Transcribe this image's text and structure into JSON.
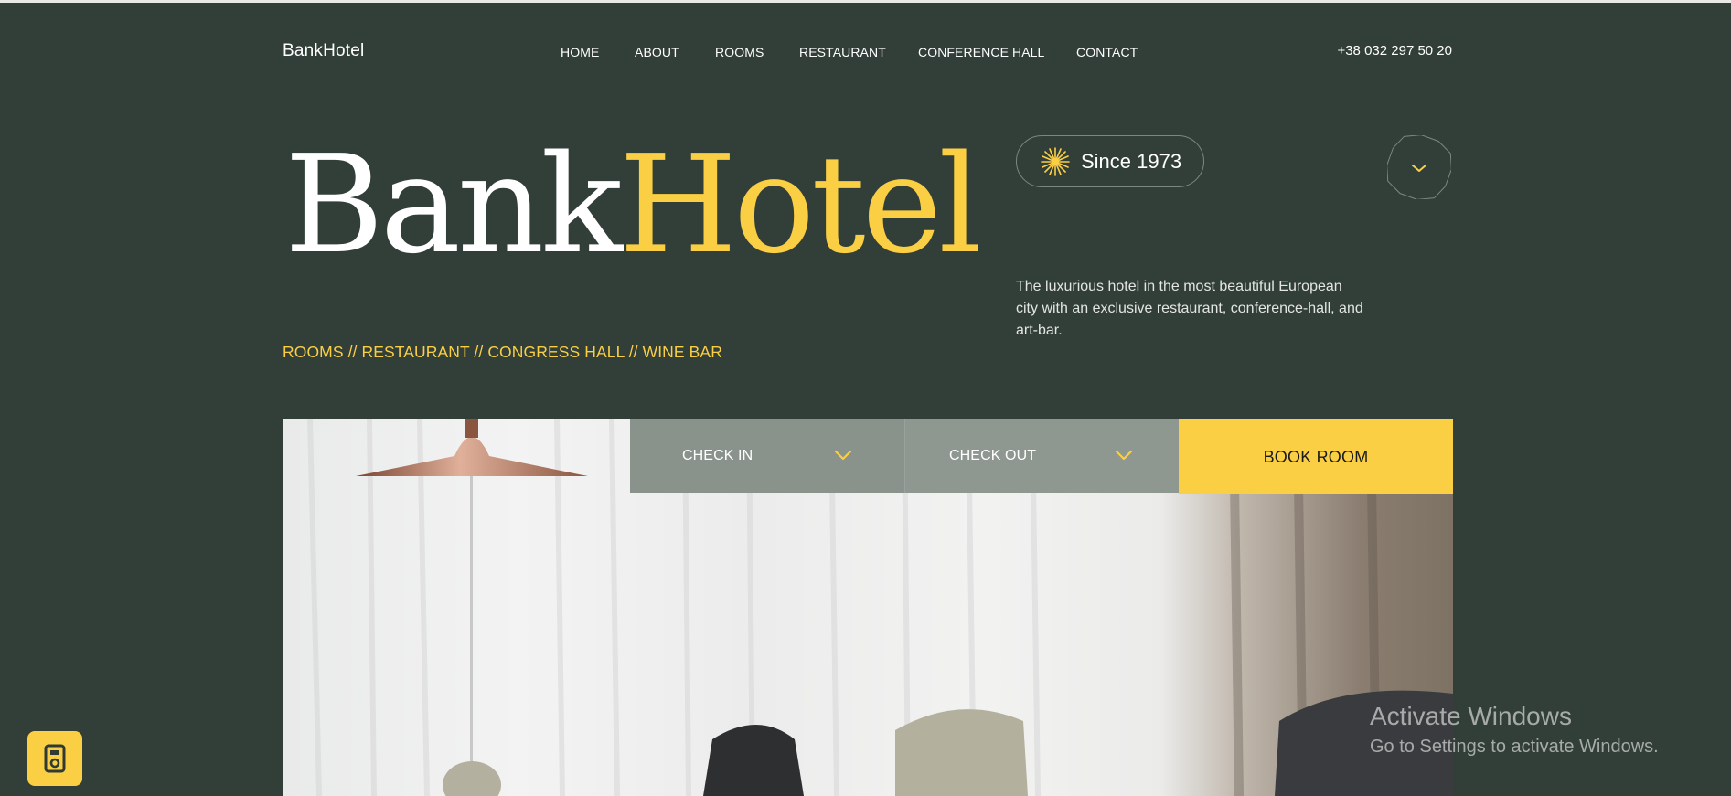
{
  "header": {
    "logo": "BankHotel",
    "nav": [
      "HOME",
      "ABOUT",
      "ROOMS",
      "RESTAURANT",
      "CONFERENCE HALL",
      "CONTACT"
    ],
    "phone": "+38 032 297 50 20"
  },
  "hero": {
    "title_part1": "Bank",
    "title_part2": "Hotel",
    "tagline": "ROOMS // RESTAURANT // CONGRESS HALL // WINE BAR",
    "since": "Since 1973",
    "description": "The luxurious hotel in the most beautiful European city with an exclusive restaurant, conference-hall, and art-bar."
  },
  "booking": {
    "check_in": "CHECK IN",
    "check_out": "CHECK OUT",
    "book": "BOOK ROOM"
  },
  "watermark": {
    "title": "Activate Windows",
    "subtitle": "Go to Settings to activate Windows."
  },
  "icons": {
    "since": "sparkle-icon",
    "scroll": "chevron-down-icon",
    "widget": "speaker-icon"
  },
  "colors": {
    "background": "#323e38",
    "accent": "#fbcf44",
    "booking_field": "#8a928c"
  }
}
